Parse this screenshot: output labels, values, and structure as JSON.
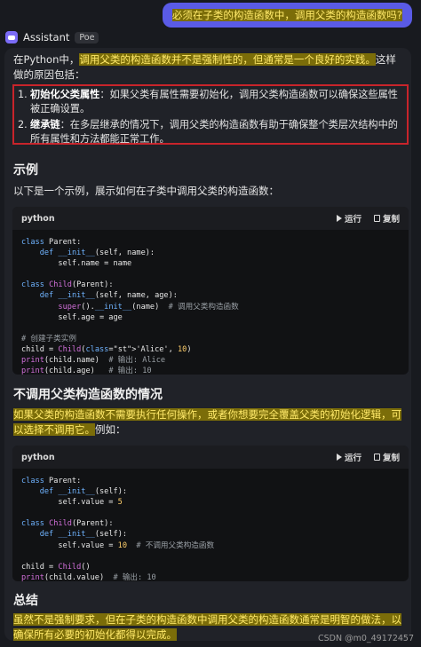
{
  "user_message": "必须在子类的构造函数中，调用父类的构造函数吗?",
  "assistant": {
    "name": "Assistant",
    "badge": "Poe"
  },
  "intro": {
    "prefix": "在Python中，",
    "highlight": "调用父类的构造函数并不是强制性的，但通常是一个良好的实践。",
    "suffix": "这样做的原因包括："
  },
  "reasons": [
    {
      "num": "1.",
      "title": "初始化父类属性",
      "text": "：如果父类有属性需要初始化，调用父类构造函数可以确保这些属性被正确设置。"
    },
    {
      "num": "2.",
      "title": "继承链",
      "text": "：在多层继承的情况下，调用父类的构造函数有助于确保整个类层次结构中的所有属性和方法都能正常工作。"
    }
  ],
  "section1": {
    "title": "示例",
    "text": "以下是一个示例，展示如何在子类中调用父类的构造函数："
  },
  "code_header": {
    "lang": "python",
    "run": "运行",
    "copy": "复制"
  },
  "section2": {
    "title": "不调用父类构造函数的情况",
    "highlight": "如果父类的构造函数不需要执行任何操作，或者你想要完全覆盖父类的初始化逻辑，可以选择不调用它。",
    "suffix": "例如："
  },
  "section3": {
    "title": "总结",
    "highlight": "虽然不是强制要求，但在子类的构造函数中调用父类的构造函数通常是明智的做法，以确保所有必要的初始化都得以完成。"
  },
  "code1_text": "class Parent:\n    def __init__(self, name):\n        self.name = name\n\nclass Child(Parent):\n    def __init__(self, name, age):\n        super().__init__(name)  # 调用父类构造函数\n        self.age = age\n\n# 创建子类实例\nchild = Child('Alice', 10)\nprint(child.name)  # 输出: Alice\nprint(child.age)   # 输出: 10",
  "code2_text": "class Parent:\n    def __init__(self):\n        self.value = 5\n\nclass Child(Parent):\n    def __init__(self):\n        self.value = 10  # 不调用父类构造函数\n\nchild = Child()\nprint(child.value)  # 输出: 10",
  "watermark": "CSDN @m0_49172457"
}
